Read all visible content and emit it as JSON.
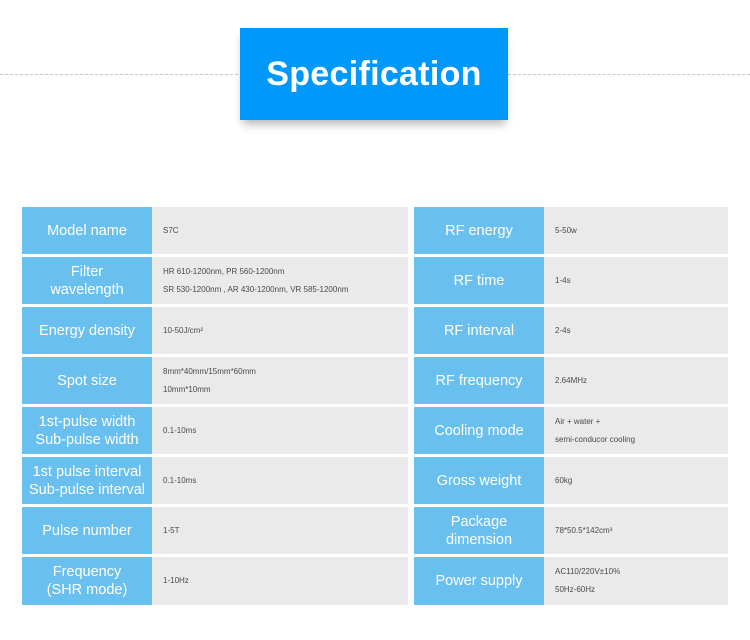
{
  "header": {
    "title": "Specification",
    "banner_color": "#0099FB",
    "divider_style": "dashed"
  },
  "theme": {
    "label_blue": "#69BFEE",
    "value_gray": "#EAEAEA",
    "banner_blue": "#0099FB",
    "value_text": "#4a4a4a",
    "label_text": "#ffffff"
  },
  "tables": {
    "left": {
      "rows": [
        {
          "label_lines": [
            "Model name"
          ],
          "value_lines": [
            "S7C"
          ]
        },
        {
          "label_lines": [
            "Filter",
            "wavelength"
          ],
          "value_lines": [
            "HR 610-1200nm,  PR 560-1200nm",
            "SR 530-1200nm , AR 430-1200nm, VR 585-1200nm"
          ]
        },
        {
          "label_lines": [
            "Energy density"
          ],
          "value_lines": [
            "10-50J/cm²"
          ]
        },
        {
          "label_lines": [
            "Spot size"
          ],
          "value_lines": [
            "8mm*40mm/15mm*60mm",
            "10mm*10mm"
          ]
        },
        {
          "label_lines": [
            "1st-pulse width",
            "Sub-pulse width"
          ],
          "value_lines": [
            "0.1-10ms"
          ]
        },
        {
          "label_lines": [
            "1st pulse interval",
            "Sub-pulse interval"
          ],
          "value_lines": [
            "0.1-10ms"
          ]
        },
        {
          "label_lines": [
            "Pulse number"
          ],
          "value_lines": [
            "1-5T"
          ]
        },
        {
          "label_lines": [
            "Frequency",
            "(SHR mode)"
          ],
          "value_lines": [
            "1-10Hz"
          ]
        }
      ]
    },
    "right": {
      "rows": [
        {
          "label_lines": [
            "RF energy"
          ],
          "value_lines": [
            "5-50w"
          ]
        },
        {
          "label_lines": [
            "RF time"
          ],
          "value_lines": [
            "1-4s"
          ]
        },
        {
          "label_lines": [
            "RF interval"
          ],
          "value_lines": [
            "2-4s"
          ]
        },
        {
          "label_lines": [
            "RF frequency"
          ],
          "value_lines": [
            "2.64MHz"
          ]
        },
        {
          "label_lines": [
            "Cooling mode"
          ],
          "value_lines": [
            "Air + water +",
            "semi-conducor cooling"
          ]
        },
        {
          "label_lines": [
            "Gross weight"
          ],
          "value_lines": [
            "60kg"
          ]
        },
        {
          "label_lines": [
            "Package",
            "dimension"
          ],
          "value_lines": [
            "78*50.5*142cm³"
          ]
        },
        {
          "label_lines": [
            "Power supply"
          ],
          "value_lines": [
            "AC110/220V±10%",
            "50Hz-60Hz"
          ]
        }
      ]
    }
  }
}
